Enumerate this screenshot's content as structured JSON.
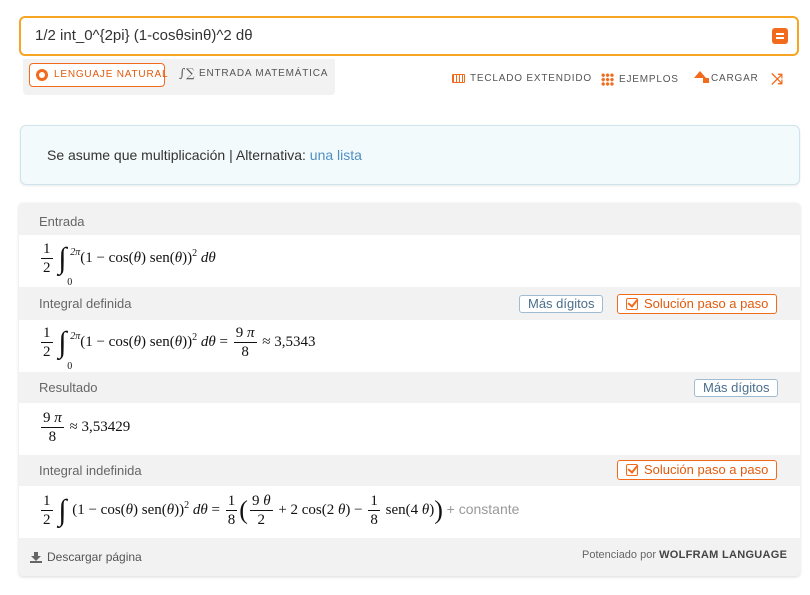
{
  "search": {
    "query": "1/2 int_0^{2pi} (1-cosθsinθ)^2 dθ"
  },
  "modes": {
    "natural": "LENGUAJE NATURAL",
    "math": "ENTRADA MATEMÁTICA"
  },
  "toolbar": {
    "keyboard": "TECLADO EXTENDIDO",
    "examples": "EJEMPLOS",
    "upload": "CARGAR"
  },
  "assumption": {
    "text": "Se asume que multiplicación | Alternativa:",
    "link": "una lista"
  },
  "pods": {
    "input": {
      "title": "Entrada"
    },
    "definite": {
      "title": "Integral definida",
      "more_digits": "Más dígitos",
      "step": "Solución paso a paso",
      "approx": "≈ 3,5343"
    },
    "result": {
      "title": "Resultado",
      "more_digits": "Más dígitos",
      "approx": "≈ 3,53429"
    },
    "indefinite": {
      "title": "Integral indefinida",
      "step": "Solución paso a paso",
      "constant": "+ constante"
    }
  },
  "footer": {
    "download": "Descargar página",
    "powered_prefix": "Potenciado por",
    "powered_brand": "WOLFRAM LANGUAGE"
  },
  "colors": {
    "accent": "#f26b1d",
    "search_border": "#f6a623",
    "link": "#4f8fc2"
  },
  "icons": [
    "equals-icon",
    "gear-icon",
    "math-input-icon",
    "keyboard-icon",
    "dots-grid-icon",
    "upload-icon",
    "shuffle-icon",
    "checkbox-icon",
    "download-icon"
  ]
}
